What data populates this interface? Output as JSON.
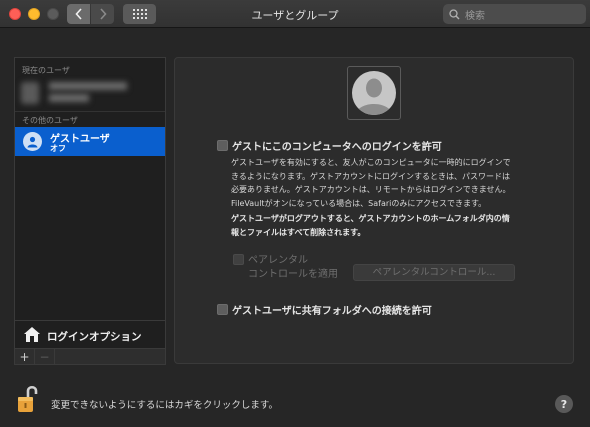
{
  "window": {
    "title": "ユーザとグループ",
    "search_placeholder": "検索"
  },
  "sidebar": {
    "current_users_label": "現在のユーザ",
    "other_users_label": "その他のユーザ",
    "guest_user": {
      "name": "ゲストユーザ",
      "status": "オフ"
    },
    "login_options_label": "ログインオプション",
    "add_label": "+",
    "remove_label": "−"
  },
  "main": {
    "allow_guest_login": {
      "label": "ゲストにこのコンピュータへのログインを許可",
      "checked": false
    },
    "description_lines": [
      "ゲストユーザを有効にすると、友人がこのコンピュータに一時的にログインで",
      "きるようになります。ゲストアカウントにログインするときは、パスワードは",
      "必要ありません。ゲストアカウントは、リモートからはログインできません。",
      "FileVaultがオンになっている場合は、Safariのみにアクセスできます。"
    ],
    "warning_lines": [
      "ゲストユーザがログアウトすると、ゲストアカウントのホームフォルダ内の情",
      "報とファイルはすべて削除されます。"
    ],
    "parental": {
      "label_line1": "ペアレンタル",
      "label_line2": "コントロールを適用",
      "button_label": "ペアレンタルコントロール...",
      "enabled": false
    },
    "allow_shared_folders": {
      "label": "ゲストユーザに共有フォルダへの接続を許可",
      "checked": false
    }
  },
  "footer": {
    "lock_text": "変更できないようにするにはカギをクリックします。",
    "help_label": "?"
  },
  "colors": {
    "selection": "#0a5fce",
    "close": "#fe5f57",
    "minimize": "#febc2e",
    "lock_orange": "#e8a23a"
  }
}
